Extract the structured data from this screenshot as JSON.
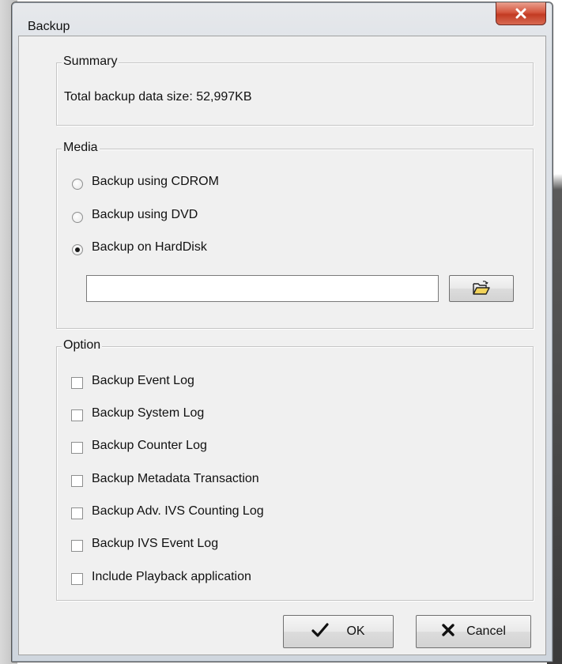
{
  "window": {
    "title": "Backup",
    "close_glyph": "×"
  },
  "summary": {
    "legend": "Summary",
    "total_text": "Total backup data size: 52,997KB"
  },
  "media": {
    "legend": "Media",
    "options": [
      {
        "label": "Backup using CDROM",
        "checked": false
      },
      {
        "label": "Backup using DVD",
        "checked": false
      },
      {
        "label": "Backup on HardDisk",
        "checked": true
      }
    ],
    "path_value": "",
    "browse_icon": "open-folder-icon"
  },
  "option": {
    "legend": "Option",
    "items": [
      {
        "label": "Backup Event Log",
        "checked": false
      },
      {
        "label": "Backup System Log",
        "checked": false
      },
      {
        "label": "Backup Counter Log",
        "checked": false
      },
      {
        "label": "Backup Metadata Transaction",
        "checked": false
      },
      {
        "label": "Backup Adv. IVS Counting Log",
        "checked": false
      },
      {
        "label": "Backup IVS Event Log",
        "checked": false
      },
      {
        "label": "Include Playback application",
        "checked": false
      }
    ]
  },
  "buttons": {
    "ok_label": "OK",
    "ok_icon": "checkmark-icon",
    "cancel_label": "Cancel",
    "cancel_icon": "x-mark-icon"
  },
  "colors": {
    "close_button": "#c8442b",
    "dialog_background": "#f0f0f0"
  }
}
